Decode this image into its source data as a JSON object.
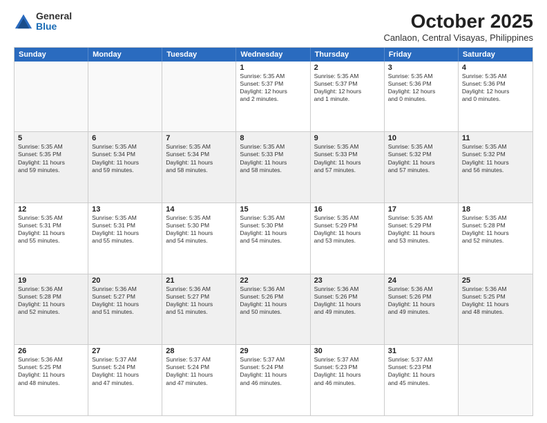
{
  "logo": {
    "general": "General",
    "blue": "Blue"
  },
  "header": {
    "month": "October 2025",
    "location": "Canlaon, Central Visayas, Philippines"
  },
  "days_of_week": [
    "Sunday",
    "Monday",
    "Tuesday",
    "Wednesday",
    "Thursday",
    "Friday",
    "Saturday"
  ],
  "weeks": [
    [
      {
        "day": "",
        "info": ""
      },
      {
        "day": "",
        "info": ""
      },
      {
        "day": "",
        "info": ""
      },
      {
        "day": "1",
        "info": "Sunrise: 5:35 AM\nSunset: 5:37 PM\nDaylight: 12 hours\nand 2 minutes."
      },
      {
        "day": "2",
        "info": "Sunrise: 5:35 AM\nSunset: 5:37 PM\nDaylight: 12 hours\nand 1 minute."
      },
      {
        "day": "3",
        "info": "Sunrise: 5:35 AM\nSunset: 5:36 PM\nDaylight: 12 hours\nand 0 minutes."
      },
      {
        "day": "4",
        "info": "Sunrise: 5:35 AM\nSunset: 5:36 PM\nDaylight: 12 hours\nand 0 minutes."
      }
    ],
    [
      {
        "day": "5",
        "info": "Sunrise: 5:35 AM\nSunset: 5:35 PM\nDaylight: 11 hours\nand 59 minutes."
      },
      {
        "day": "6",
        "info": "Sunrise: 5:35 AM\nSunset: 5:34 PM\nDaylight: 11 hours\nand 59 minutes."
      },
      {
        "day": "7",
        "info": "Sunrise: 5:35 AM\nSunset: 5:34 PM\nDaylight: 11 hours\nand 58 minutes."
      },
      {
        "day": "8",
        "info": "Sunrise: 5:35 AM\nSunset: 5:33 PM\nDaylight: 11 hours\nand 58 minutes."
      },
      {
        "day": "9",
        "info": "Sunrise: 5:35 AM\nSunset: 5:33 PM\nDaylight: 11 hours\nand 57 minutes."
      },
      {
        "day": "10",
        "info": "Sunrise: 5:35 AM\nSunset: 5:32 PM\nDaylight: 11 hours\nand 57 minutes."
      },
      {
        "day": "11",
        "info": "Sunrise: 5:35 AM\nSunset: 5:32 PM\nDaylight: 11 hours\nand 56 minutes."
      }
    ],
    [
      {
        "day": "12",
        "info": "Sunrise: 5:35 AM\nSunset: 5:31 PM\nDaylight: 11 hours\nand 55 minutes."
      },
      {
        "day": "13",
        "info": "Sunrise: 5:35 AM\nSunset: 5:31 PM\nDaylight: 11 hours\nand 55 minutes."
      },
      {
        "day": "14",
        "info": "Sunrise: 5:35 AM\nSunset: 5:30 PM\nDaylight: 11 hours\nand 54 minutes."
      },
      {
        "day": "15",
        "info": "Sunrise: 5:35 AM\nSunset: 5:30 PM\nDaylight: 11 hours\nand 54 minutes."
      },
      {
        "day": "16",
        "info": "Sunrise: 5:35 AM\nSunset: 5:29 PM\nDaylight: 11 hours\nand 53 minutes."
      },
      {
        "day": "17",
        "info": "Sunrise: 5:35 AM\nSunset: 5:29 PM\nDaylight: 11 hours\nand 53 minutes."
      },
      {
        "day": "18",
        "info": "Sunrise: 5:35 AM\nSunset: 5:28 PM\nDaylight: 11 hours\nand 52 minutes."
      }
    ],
    [
      {
        "day": "19",
        "info": "Sunrise: 5:36 AM\nSunset: 5:28 PM\nDaylight: 11 hours\nand 52 minutes."
      },
      {
        "day": "20",
        "info": "Sunrise: 5:36 AM\nSunset: 5:27 PM\nDaylight: 11 hours\nand 51 minutes."
      },
      {
        "day": "21",
        "info": "Sunrise: 5:36 AM\nSunset: 5:27 PM\nDaylight: 11 hours\nand 51 minutes."
      },
      {
        "day": "22",
        "info": "Sunrise: 5:36 AM\nSunset: 5:26 PM\nDaylight: 11 hours\nand 50 minutes."
      },
      {
        "day": "23",
        "info": "Sunrise: 5:36 AM\nSunset: 5:26 PM\nDaylight: 11 hours\nand 49 minutes."
      },
      {
        "day": "24",
        "info": "Sunrise: 5:36 AM\nSunset: 5:26 PM\nDaylight: 11 hours\nand 49 minutes."
      },
      {
        "day": "25",
        "info": "Sunrise: 5:36 AM\nSunset: 5:25 PM\nDaylight: 11 hours\nand 48 minutes."
      }
    ],
    [
      {
        "day": "26",
        "info": "Sunrise: 5:36 AM\nSunset: 5:25 PM\nDaylight: 11 hours\nand 48 minutes."
      },
      {
        "day": "27",
        "info": "Sunrise: 5:37 AM\nSunset: 5:24 PM\nDaylight: 11 hours\nand 47 minutes."
      },
      {
        "day": "28",
        "info": "Sunrise: 5:37 AM\nSunset: 5:24 PM\nDaylight: 11 hours\nand 47 minutes."
      },
      {
        "day": "29",
        "info": "Sunrise: 5:37 AM\nSunset: 5:24 PM\nDaylight: 11 hours\nand 46 minutes."
      },
      {
        "day": "30",
        "info": "Sunrise: 5:37 AM\nSunset: 5:23 PM\nDaylight: 11 hours\nand 46 minutes."
      },
      {
        "day": "31",
        "info": "Sunrise: 5:37 AM\nSunset: 5:23 PM\nDaylight: 11 hours\nand 45 minutes."
      },
      {
        "day": "",
        "info": ""
      }
    ]
  ]
}
